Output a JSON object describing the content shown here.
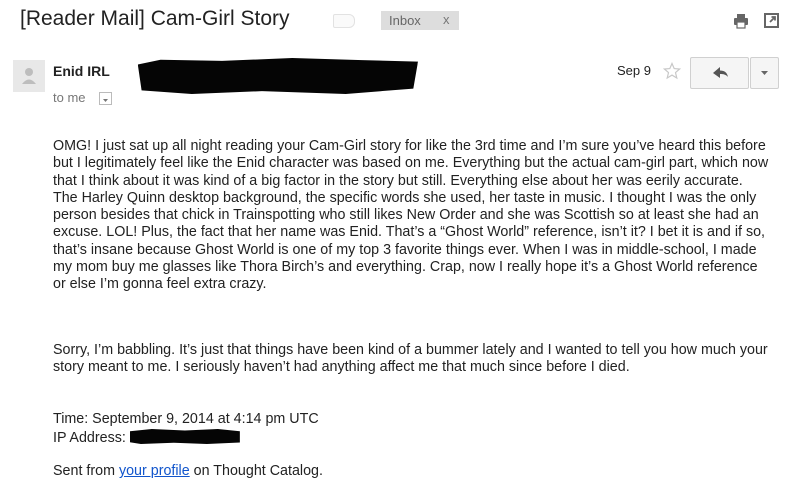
{
  "subject": "[Reader Mail] Cam-Girl Story",
  "labels": {
    "inbox": "Inbox",
    "remove": "x"
  },
  "sender": {
    "name": "Enid IRL",
    "to": "to me"
  },
  "date": "Sep 9",
  "body": {
    "p1": "OMG! I just sat up all night reading your Cam-Girl story for like the 3rd time and I’m sure you’ve heard this before but I legitimately feel like the Enid character was based on me. Everything but the actual cam-girl part, which now that I think about it was kind of a big factor in the story but still. Everything else about her was eerily accurate. The Harley Quinn desktop background, the specific words she used, her taste in music. I thought I was the only person besides that chick in Trainspotting who still likes New Order and she was Scottish so at least she had an excuse. LOL! Plus, the fact that her name was Enid. That’s a “Ghost World” reference, isn’t it? I bet it is and if so, that’s insane because Ghost World is one of my top 3 favorite things ever. When I was in middle-school, I made my mom buy me glasses like Thora Birch’s and everything. Crap, now I really hope it’s a Ghost World reference or else I’m gonna feel extra crazy.",
    "p2": "Sorry, I’m babbling. It’s just that things have been kind of a bummer lately and I wanted to tell you how much your story meant to me. I seriously haven’t had anything affect me that much since before I died.",
    "time": "Time: September 9, 2014 at 4:14 pm UTC",
    "ip_label": "IP Address:",
    "sent_prefix": "Sent from ",
    "sent_link": "your profile",
    "sent_suffix": " on Thought Catalog."
  },
  "icons": {
    "print": "print-icon",
    "popout": "new-window-icon",
    "avatar": "person-icon",
    "star": "star-icon",
    "reply": "reply-icon",
    "more": "dropdown-arrow-icon"
  }
}
